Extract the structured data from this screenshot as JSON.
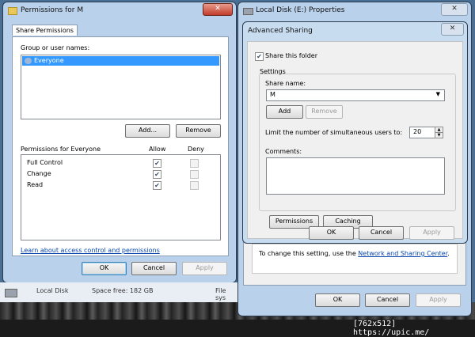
{
  "background": {
    "explorer": {
      "drive": "Local Disk",
      "free": "Space free: 182 GB",
      "fs": "File sys"
    },
    "watermark": "[762x512] https://upic.me/"
  },
  "permissions_window": {
    "title": "Permissions for M",
    "close": "✕",
    "tab": "Share Permissions",
    "users_label": "Group or user names:",
    "users": [
      "Everyone"
    ],
    "add": "Add...",
    "remove": "Remove",
    "perm_label": "Permissions for Everyone",
    "allow": "Allow",
    "deny": "Deny",
    "perms": [
      {
        "name": "Full Control",
        "allow": true,
        "deny": false
      },
      {
        "name": "Change",
        "allow": true,
        "deny": false
      },
      {
        "name": "Read",
        "allow": true,
        "deny": false
      }
    ],
    "link": "Learn about access control and permissions",
    "ok": "OK",
    "cancel": "Cancel",
    "apply": "Apply"
  },
  "properties_window": {
    "title": "Local Disk (E:) Properties",
    "close": "✕",
    "info_text": "To change this setting, use the ",
    "info_link": "Network and Sharing Center",
    "info_end": ".",
    "ok": "OK",
    "cancel": "Cancel",
    "apply": "Apply"
  },
  "advanced_sharing": {
    "title": "Advanced Sharing",
    "close": "✕",
    "share_check": "Share this folder",
    "share_checked": true,
    "settings": "Settings",
    "share_name_label": "Share name:",
    "share_name": "M",
    "add": "Add",
    "remove": "Remove",
    "limit_label": "Limit the number of simultaneous users to:",
    "limit_value": "20",
    "comments_label": "Comments:",
    "permissions": "Permissions",
    "caching": "Caching",
    "ok": "OK",
    "cancel": "Cancel",
    "apply": "Apply"
  }
}
